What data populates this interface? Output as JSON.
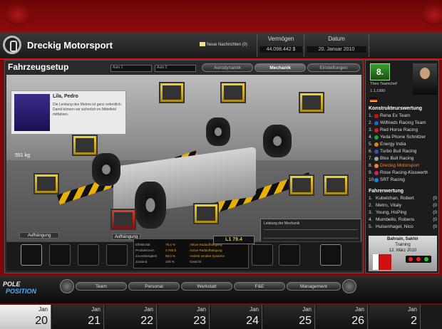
{
  "header": {
    "team_name": "Dreckig Motorsport",
    "news": "Neue Nachrichten (0)",
    "vermoegen_label": "Vermögen",
    "vermoegen_value": "44.098.442 $",
    "datum_label": "Datum",
    "datum_value": "20. Januar 2010"
  },
  "main": {
    "title": "Fahrzeugsetup",
    "select1": "Auto 1",
    "select2": "Auto 2",
    "tabs": [
      {
        "label": "Aerodynamik"
      },
      {
        "label": "Mechanik"
      },
      {
        "label": "Einstellungen"
      }
    ],
    "active_tab": "Mechanik",
    "speaker_name": "Lila, Pedro",
    "speaker_text": "Die Leistung des Motors ist ganz ordentlich. Damit können wir sicherlich im Mittelfeld mitfahren.",
    "weight": "551 kg",
    "info_panel_title": "Leistung der Mechanik",
    "suspension_label": "Aufhängung",
    "suspension_label2": "Aufhängung",
    "rating": "L1 79.4",
    "stats": [
      {
        "label": "Effektivität",
        "value": "79,4 %",
        "note": "Aktive Radaufhängung"
      },
      {
        "label": "Produktionen",
        "value": "3.780 $",
        "note": "Active Radaufhängung"
      },
      {
        "label": "Zuverlässigkeit",
        "value": "89,0 %",
        "note": "Antrieb veraltet Systeme"
      },
      {
        "label": "Zustand",
        "value": "100 %",
        "note": "Gewicht"
      }
    ]
  },
  "nav": {
    "brand_line1": "POLE",
    "brand_line2": "POSITION",
    "buttons": [
      {
        "label": "Team"
      },
      {
        "label": "Personal"
      },
      {
        "label": "Werkstatt"
      },
      {
        "label": "F&E"
      },
      {
        "label": "Management"
      }
    ]
  },
  "calendar": {
    "days": [
      {
        "month": "Jan",
        "day": "20",
        "current": true
      },
      {
        "month": "Jan",
        "day": "21"
      },
      {
        "month": "Jan",
        "day": "22"
      },
      {
        "month": "Jan",
        "day": "23"
      },
      {
        "month": "Jan",
        "day": "24"
      },
      {
        "month": "Jan",
        "day": "25"
      },
      {
        "month": "Jan",
        "day": "26"
      },
      {
        "month": "Jan",
        "day": "2"
      }
    ]
  },
  "sidebar": {
    "position": "8.",
    "manager_name": "Theo Teamchef",
    "manager_date": "1.1.1980",
    "constructors_title": "Konstrukteurswertung",
    "constructors": [
      {
        "pos": "1.",
        "name": "Rena Ex Team",
        "color": "#d01010"
      },
      {
        "pos": "2.",
        "name": "Wilfrieds Racing Team",
        "color": "#2060d0"
      },
      {
        "pos": "3.",
        "name": "Red Horse Racing",
        "color": "#d02020"
      },
      {
        "pos": "4.",
        "name": "Yeda Phone Schnitzer",
        "color": "#20a040"
      },
      {
        "pos": "5.",
        "name": "Energy India",
        "color": "#e08010"
      },
      {
        "pos": "6.",
        "name": "Turbo Bull Racing",
        "color": "#3050c0"
      },
      {
        "pos": "7.",
        "name": "Blox Bull Racing",
        "color": "#a0a0a0"
      },
      {
        "pos": "8.",
        "name": "Dreckig Motorsport",
        "color": "#ff8020",
        "highlight": true
      },
      {
        "pos": "9.",
        "name": "Rose Racing-Kisswerth",
        "color": "#d02060"
      },
      {
        "pos": "10.",
        "name": "SRT Racing",
        "color": "#2080d0"
      }
    ],
    "drivers_title": "Fahrerwertung",
    "drivers": [
      {
        "pos": "1.",
        "name": "Kubelchan, Robert",
        "pts": "(0"
      },
      {
        "pos": "2.",
        "name": "Metro, Vitaly",
        "pts": "(0"
      },
      {
        "pos": "3.",
        "name": "Young, HoPing",
        "pts": "(0"
      },
      {
        "pos": "4.",
        "name": "Mumbello, Robens",
        "pts": "(0"
      },
      {
        "pos": "5.",
        "name": "Hulsenhagel, Nico",
        "pts": "(0"
      }
    ],
    "next_race_name": "Bahrain, Sakhir",
    "next_race_type": "Training",
    "next_race_date": "12. März 2010"
  }
}
